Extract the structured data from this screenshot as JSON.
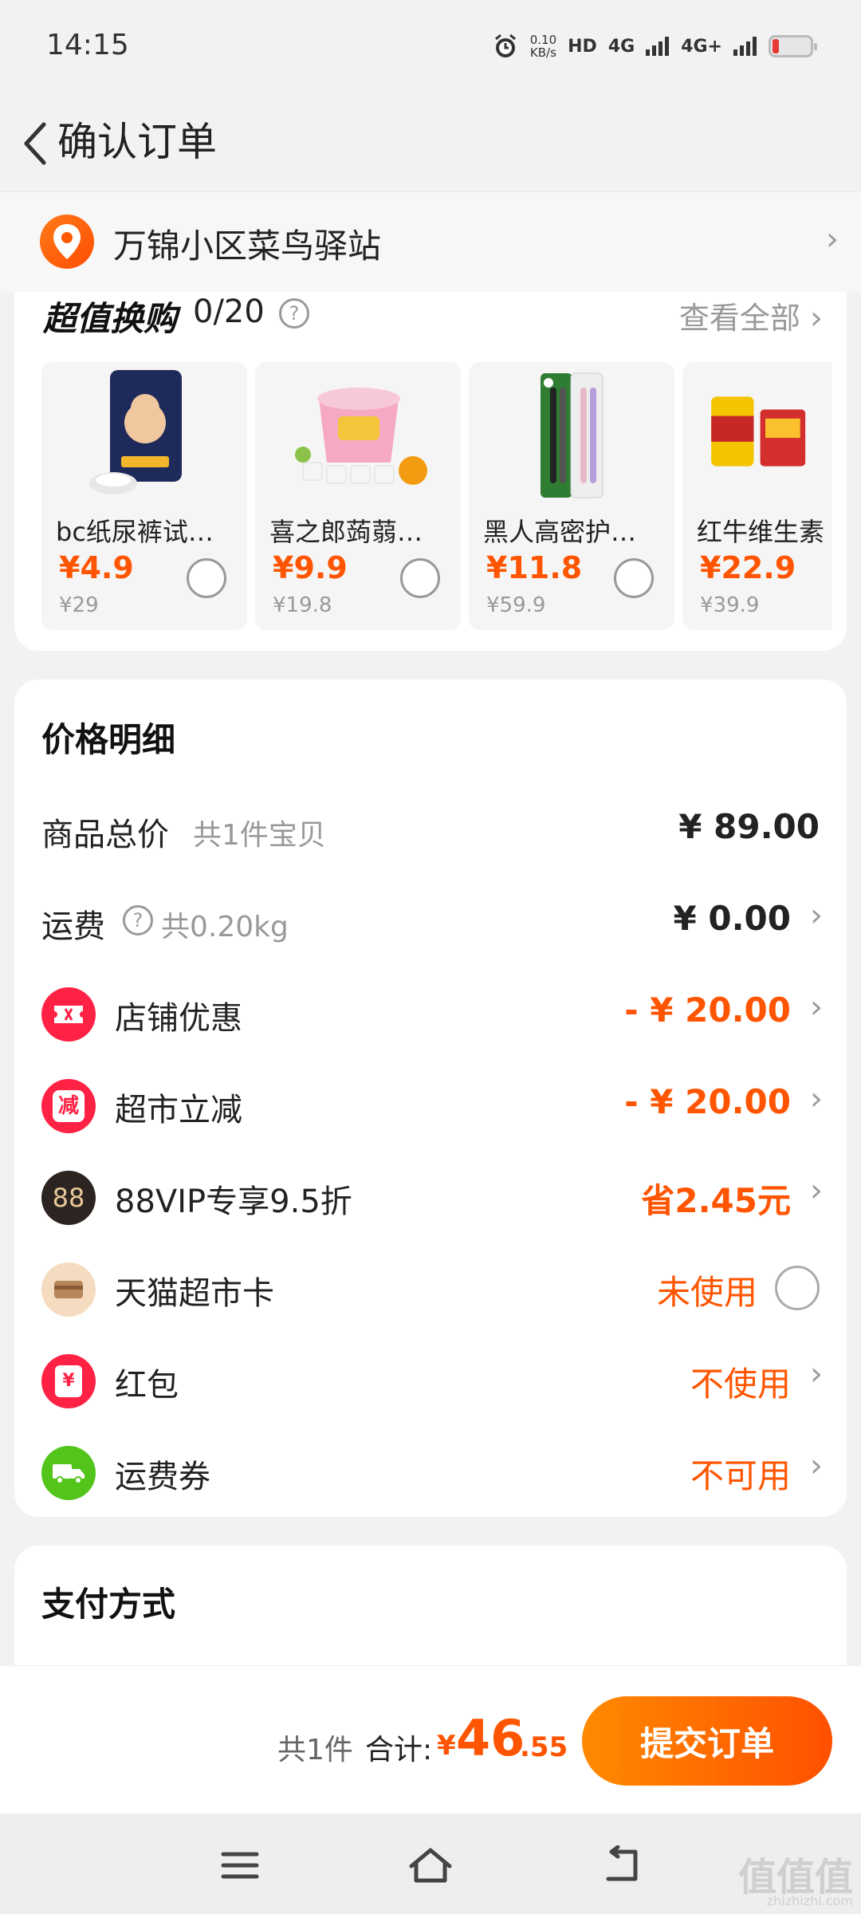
{
  "status_bar": {
    "time": "14:15",
    "speed_value": "0.10",
    "speed_unit": "KB/s",
    "hd_badge": "HD",
    "net1": "4G",
    "net2": "4G+"
  },
  "header": {
    "title": "确认订单",
    "back_icon": "chevron-left-icon"
  },
  "address": {
    "text": "万锦小区菜鸟驿站",
    "icon": "location-pin-icon"
  },
  "deals": {
    "title": "超值换购",
    "count": "0/20",
    "help": "?",
    "view_all": "查看全部 ",
    "items": [
      {
        "name": "bc纸尿裤试…",
        "price": "¥4.9",
        "original": "¥29"
      },
      {
        "name": "喜之郎蒟蒻…",
        "price": "¥9.9",
        "original": "¥19.8"
      },
      {
        "name": "黑人高密护…",
        "price": "¥11.8",
        "original": "¥59.9"
      },
      {
        "name": "红牛维生素",
        "price": "¥22.9",
        "original": "¥39.9"
      }
    ]
  },
  "price_detail": {
    "title": "价格明细",
    "goods_total": {
      "label": "商品总价",
      "sub": "共1件宝贝",
      "value": "¥ 89.00"
    },
    "shipping": {
      "label": "运费",
      "sub": "共0.20kg",
      "value": "¥ 0.00"
    },
    "store_discount": {
      "label": "店铺优惠",
      "value": "- ¥ 20.00"
    },
    "market_discount": {
      "label": "超市立减",
      "value": "- ¥ 20.00",
      "icon_text": "减"
    },
    "vip": {
      "label": "88VIP专享9.5折",
      "value": "省2.45元",
      "icon_text": "88"
    },
    "market_card": {
      "label": "天猫超市卡",
      "value": "未使用"
    },
    "red_packet": {
      "label": "红包",
      "value": "不使用",
      "icon_text": "¥"
    },
    "shipping_coupon": {
      "label": "运费券",
      "value": "不可用"
    }
  },
  "payment": {
    "title": "支付方式"
  },
  "bottom": {
    "count": "共1件",
    "total_label": "合计:",
    "yen": "¥",
    "total_int": "46",
    "total_dec": ".55",
    "submit": "提交订单"
  },
  "watermark": {
    "text": "值值值",
    "sub": "zhizhizhi.com"
  },
  "colors": {
    "accent": "#ff5500",
    "button_start": "#ff8a00",
    "button_end": "#ff5000"
  }
}
